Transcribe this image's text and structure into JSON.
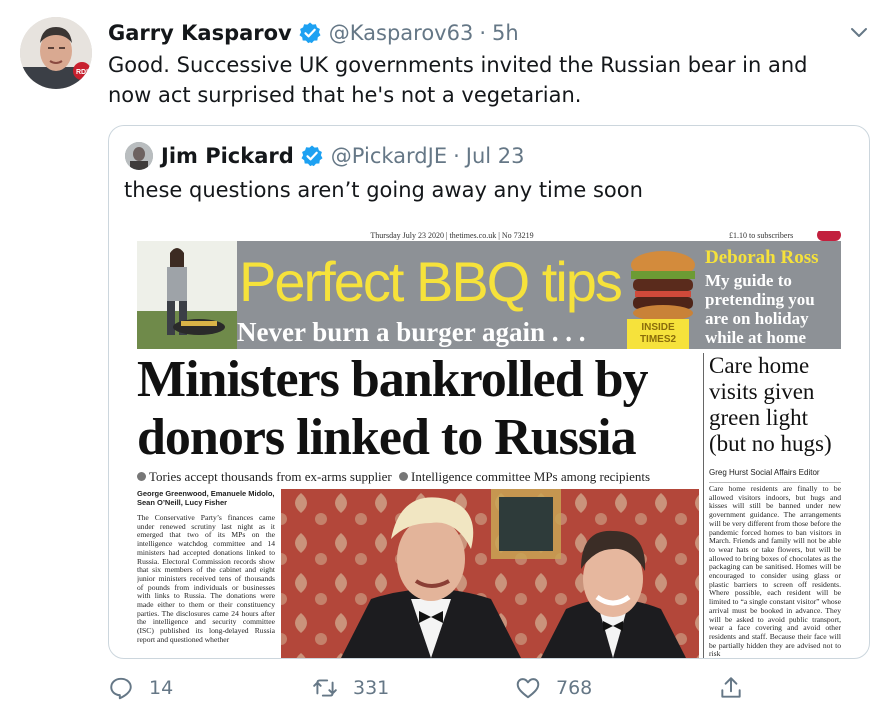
{
  "tweet": {
    "display_name": "Garry Kasparov",
    "handle": "@Kasparov63",
    "separator": "·",
    "time": "5h",
    "text": "Good. Successive UK governments invited the Russian bear in and\nnow act surprised that he's not a vegetarian.",
    "avatar_badge": "RDI"
  },
  "quoted": {
    "display_name": "Jim Pickard",
    "handle": "@PickardJE",
    "separator": "·",
    "time": "Jul 23",
    "text": "these questions aren’t going away any time soon"
  },
  "newspaper": {
    "dateline": "Thursday July 23 2020 | thetimes.co.uk | No 73219",
    "price": "£1.10 to subscribers",
    "banner_title": "Perfect BBQ tips",
    "banner_sub": "Never burn a burger again . . .",
    "inside_badge": "INSIDE\nTIMES2",
    "ross_name": "Deborah Ross",
    "ross_sub": "My guide to\npretending you\nare on holiday\nwhile at home",
    "headline": "Ministers bankrolled by\ndonors linked to Russia",
    "side_headline": "Care home\nvisits given\ngreen light\n(but no hugs)",
    "strap_1": "Tories accept thousands from ex-arms supplier",
    "strap_2": "Intelligence committee MPs among recipients",
    "side_byline": "Greg Hurst Social Affairs Editor",
    "side_body": "Care home residents are finally to be allowed visitors indoors, but hugs and kisses will still be banned under new government guidance. The arrangements will be very different from those before the pandemic forced homes to ban visitors in March. Friends and family will not be able to wear hats or take flowers, but will be allowed to bring boxes of chocolates as the packaging can be sanitised. Homes will be encouraged to consider using glass or plastic barriers to screen off residents. Where possible, each resident will be limited to “a single constant visitor” whose arrival must be booked in advance. They will be asked to avoid public transport, wear a face covering and avoid other residents and staff. Because their face will be partially hidden they are advised not to risk",
    "main_byline": "George Greenwood, Emanuele Midolo,\nSean O’Neill, Lucy Fisher",
    "main_body": "The Conservative Party’s finances came under renewed scrutiny last night as it emerged that two of its MPs on the intelligence watchdog committee and 14 ministers had accepted donations linked to Russia. Electoral Commission records show that six members of the cabinet and eight junior ministers received tens of thousands of pounds from individuals or businesses with links to Russia. The donations were made either to them or their constituency parties. The disclosures came 24 hours after the intelligence and security committee (ISC) published its long-delayed Russia report and questioned whether"
  },
  "actions": {
    "replies": "14",
    "retweets": "331",
    "likes": "768"
  },
  "icons": {
    "verified": "verified-badge-icon",
    "caret": "chevron-down-icon",
    "reply": "reply-icon",
    "retweet": "retweet-icon",
    "like": "heart-icon",
    "share": "share-icon"
  },
  "colors": {
    "verified_blue": "#1da1f2",
    "muted_text": "#657786",
    "banner_yellow": "#f6e23b"
  }
}
